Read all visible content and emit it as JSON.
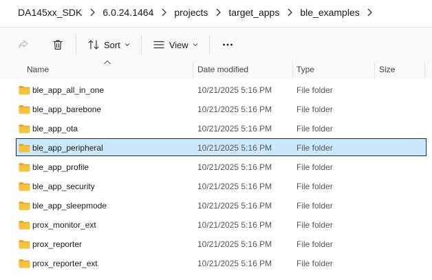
{
  "breadcrumb": [
    "DA145xx_SDK",
    "6.0.24.1464",
    "projects",
    "target_apps",
    "ble_examples"
  ],
  "toolbar": {
    "sort_label": "Sort",
    "view_label": "View",
    "share_icon": "share-icon",
    "delete_icon": "trash-icon",
    "more_icon": "more-icon"
  },
  "columns": {
    "name": "Name",
    "date": "Date modified",
    "type": "Type",
    "size": "Size"
  },
  "files": [
    {
      "name": "ble_app_all_in_one",
      "date": "10/21/2025 5:16 PM",
      "type": "File folder"
    },
    {
      "name": "ble_app_barebone",
      "date": "10/21/2025 5:16 PM",
      "type": "File folder"
    },
    {
      "name": "ble_app_ota",
      "date": "10/21/2025 5:16 PM",
      "type": "File folder"
    },
    {
      "name": "ble_app_peripheral",
      "date": "10/21/2025 5:16 PM",
      "type": "File folder"
    },
    {
      "name": "ble_app_profile",
      "date": "10/21/2025 5:16 PM",
      "type": "File folder"
    },
    {
      "name": "ble_app_security",
      "date": "10/21/2025 5:16 PM",
      "type": "File folder"
    },
    {
      "name": "ble_app_sleepmode",
      "date": "10/21/2025 5:16 PM",
      "type": "File folder"
    },
    {
      "name": "prox_monitor_ext",
      "date": "10/21/2025 5:16 PM",
      "type": "File folder"
    },
    {
      "name": "prox_reporter",
      "date": "10/21/2025 5:16 PM",
      "type": "File folder"
    },
    {
      "name": "prox_reporter_ext",
      "date": "10/21/2025 5:16 PM",
      "type": "File folder"
    }
  ],
  "colors": {
    "folder": "#f5c242",
    "folder_dark": "#e8a922",
    "selection_bg": "#cce8ff",
    "selection_border": "#1f2a44"
  }
}
